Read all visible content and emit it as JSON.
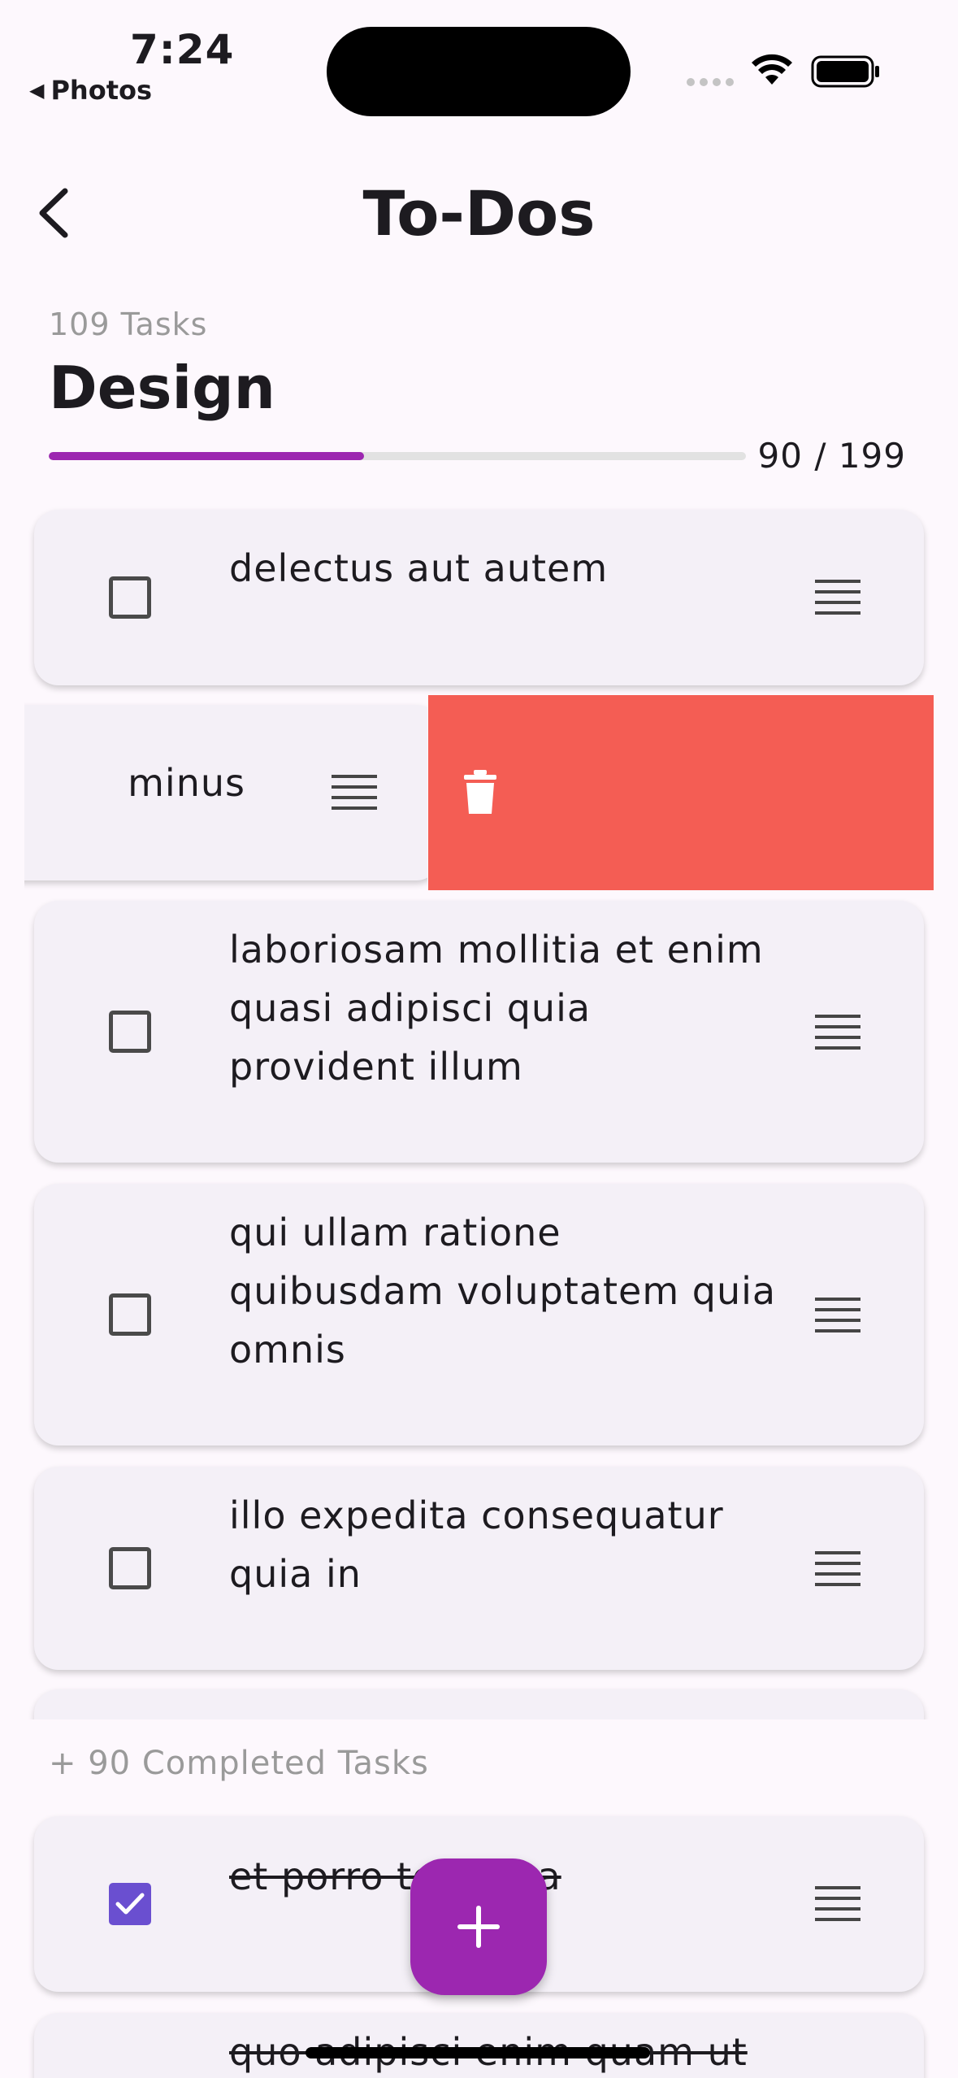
{
  "status": {
    "time": "7:24",
    "back_app": "Photos"
  },
  "app_bar": {
    "title": "To-Dos"
  },
  "list": {
    "task_count": "109 Tasks",
    "name": "Design",
    "progress_text": "90 / 199",
    "progress_fraction": 0.452,
    "accent_color": "#9c27b0"
  },
  "tasks": [
    {
      "text": "delectus aut autem",
      "done": false
    },
    {
      "text": "minus",
      "done": false
    },
    {
      "text": "laboriosam mollitia et enim quasi adipisci quia provident illum",
      "done": false
    },
    {
      "text": "qui ullam ratione quibusdam voluptatem quia omnis",
      "done": false
    },
    {
      "text": "illo expedita consequatur quia in",
      "done": false
    }
  ],
  "swipe_action": {
    "icon": "trash-icon",
    "color": "#f45d54"
  },
  "completed": {
    "label": "+ 90 Completed Tasks",
    "tasks": [
      {
        "text": "et porro tempora",
        "done": true
      },
      {
        "text": "quo adipisci enim quam ut",
        "done": true
      }
    ]
  },
  "fab": {
    "icon": "plus-icon"
  }
}
